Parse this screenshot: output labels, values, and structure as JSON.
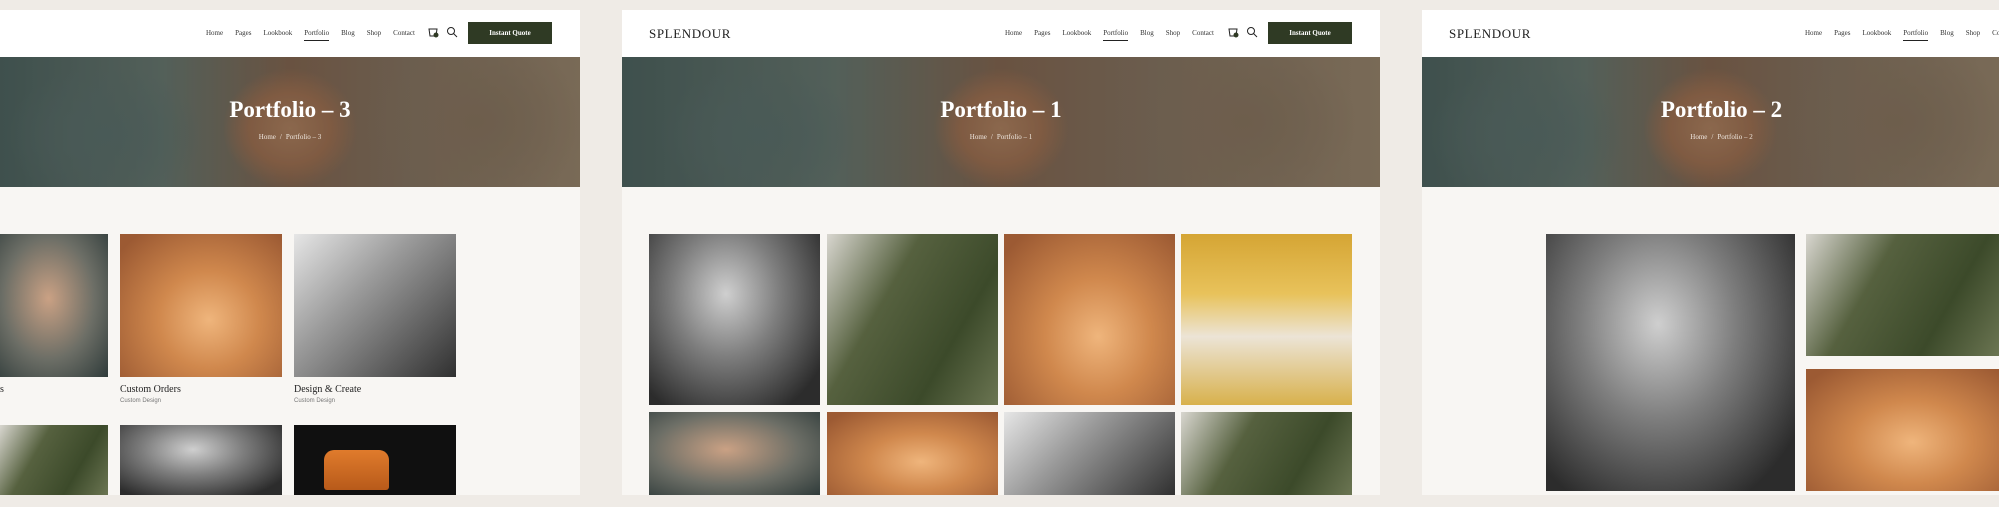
{
  "site": {
    "logo": "SPLENDOUR"
  },
  "nav": [
    "Home",
    "Pages",
    "Lookbook",
    "Portfolio",
    "Blog",
    "Shop",
    "Contact"
  ],
  "cta_label": "Instant Quote",
  "colors": {
    "cta": "#2f3a24",
    "page_bg": "#efebe6",
    "panel_bg": "#f8f6f3"
  },
  "panels": [
    {
      "title": "Portfolio – 3",
      "breadcrumb": [
        "Home",
        "Portfolio – 3"
      ],
      "items": [
        {
          "title": "s"
        },
        {
          "title": "Custom Orders",
          "category": "Custom Design"
        },
        {
          "title": "Design & Create",
          "category": "Custom Design"
        }
      ]
    },
    {
      "title": "Portfolio – 1",
      "breadcrumb": [
        "Home",
        "Portfolio – 1"
      ]
    },
    {
      "title": "Portfolio – 2",
      "breadcrumb": [
        "Home",
        "Portfolio – 2"
      ]
    }
  ]
}
